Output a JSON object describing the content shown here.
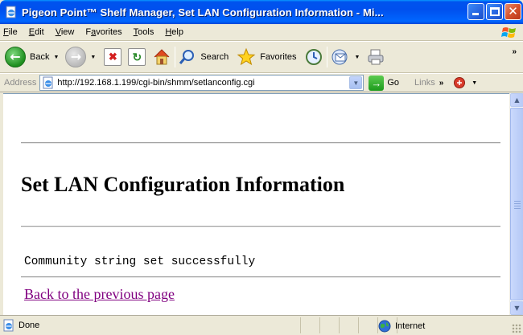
{
  "window": {
    "title": "Pigeon Point™ Shelf Manager, Set LAN Configuration Information - Mi...",
    "minimize_label": "",
    "maximize_label": "",
    "close_label": "✕"
  },
  "menu": {
    "items": [
      {
        "label": "File",
        "accel": "F"
      },
      {
        "label": "Edit",
        "accel": "E"
      },
      {
        "label": "View",
        "accel": "V"
      },
      {
        "label": "Favorites",
        "accel": "a"
      },
      {
        "label": "Tools",
        "accel": "T"
      },
      {
        "label": "Help",
        "accel": "H"
      }
    ]
  },
  "toolbar": {
    "back_label": "Back",
    "search_label": "Search",
    "favorites_label": "Favorites",
    "overflow": "»"
  },
  "address": {
    "label": "Address",
    "url": "http://192.168.1.199/cgi-bin/shmm/setlanconfig.cgi",
    "go_label": "Go",
    "links_label": "Links",
    "links_overflow": "»"
  },
  "page": {
    "heading": "Set LAN Configuration Information",
    "message": "Community string set successfully",
    "back_link": "Back to the previous page"
  },
  "status": {
    "text": "Done",
    "zone": "Internet"
  },
  "colors": {
    "titlebar": "#0054e3",
    "visited_link": "#800080",
    "chrome": "#ece9d8"
  }
}
